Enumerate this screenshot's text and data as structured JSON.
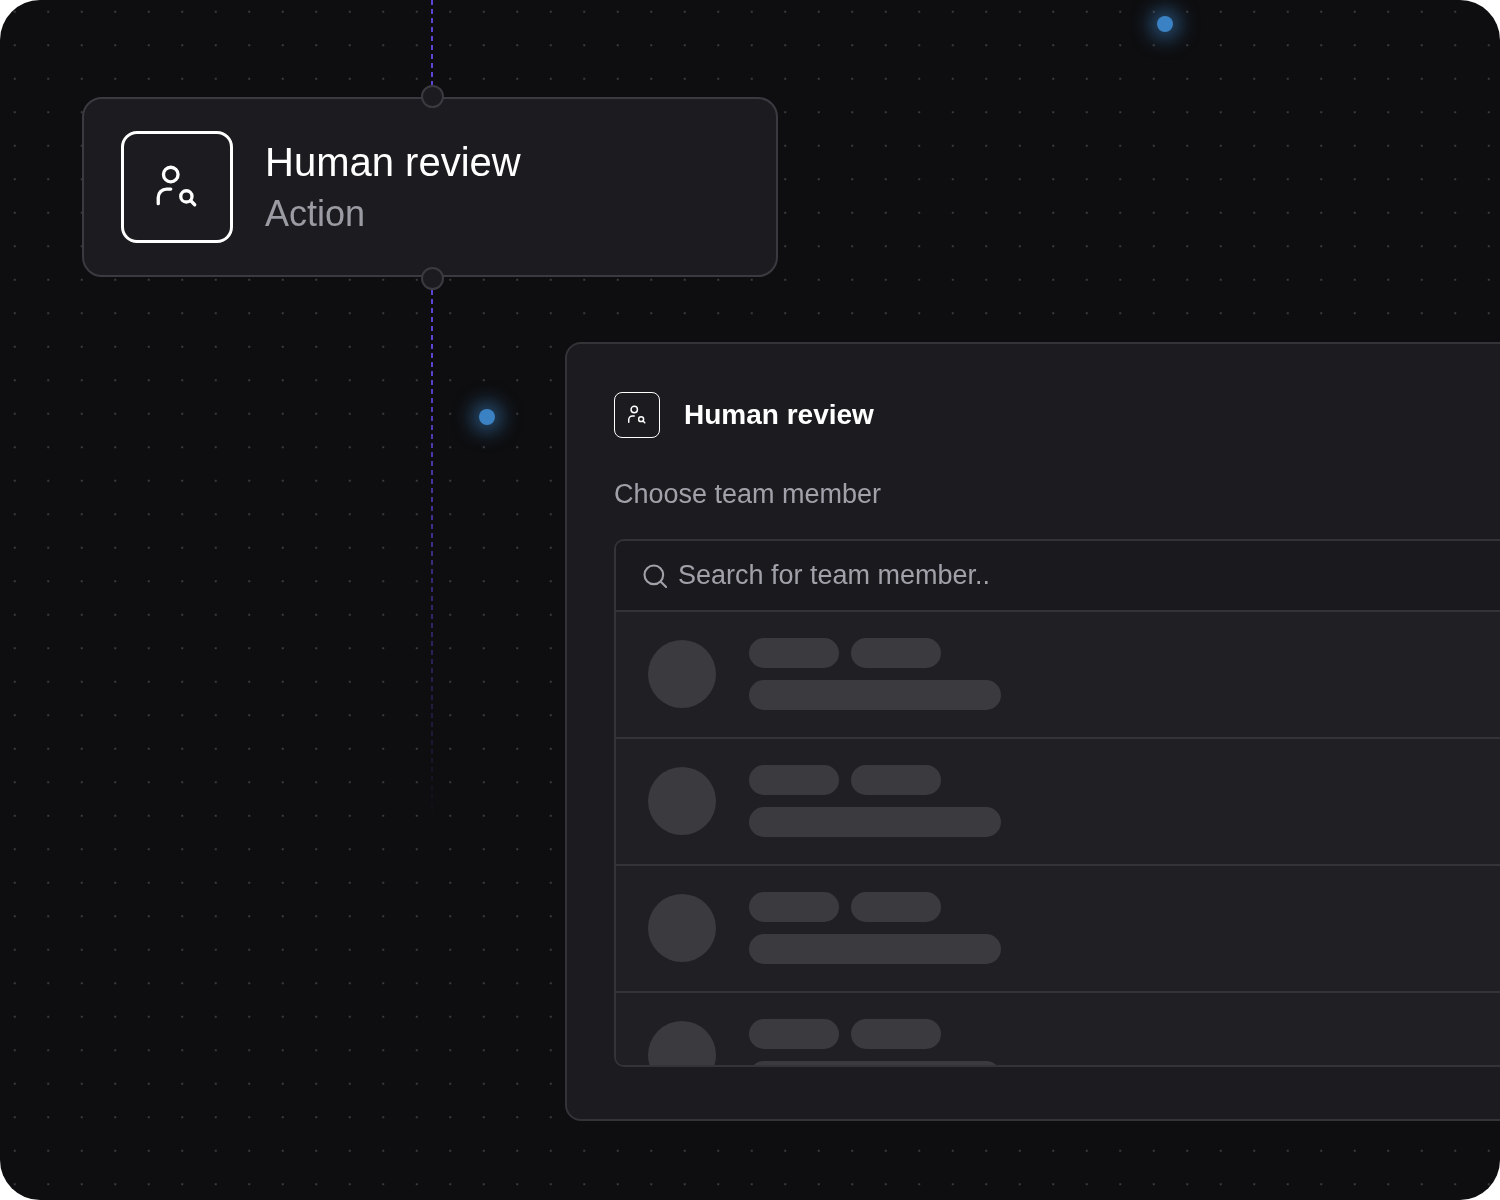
{
  "node": {
    "title": "Human review",
    "subtitle": "Action"
  },
  "panel": {
    "title": "Human review",
    "label": "Choose team member",
    "search": {
      "placeholder": "Search for team member.."
    },
    "rows": [
      {
        "kind": "skeleton"
      },
      {
        "kind": "skeleton"
      },
      {
        "kind": "skeleton"
      },
      {
        "kind": "skeleton"
      }
    ]
  }
}
